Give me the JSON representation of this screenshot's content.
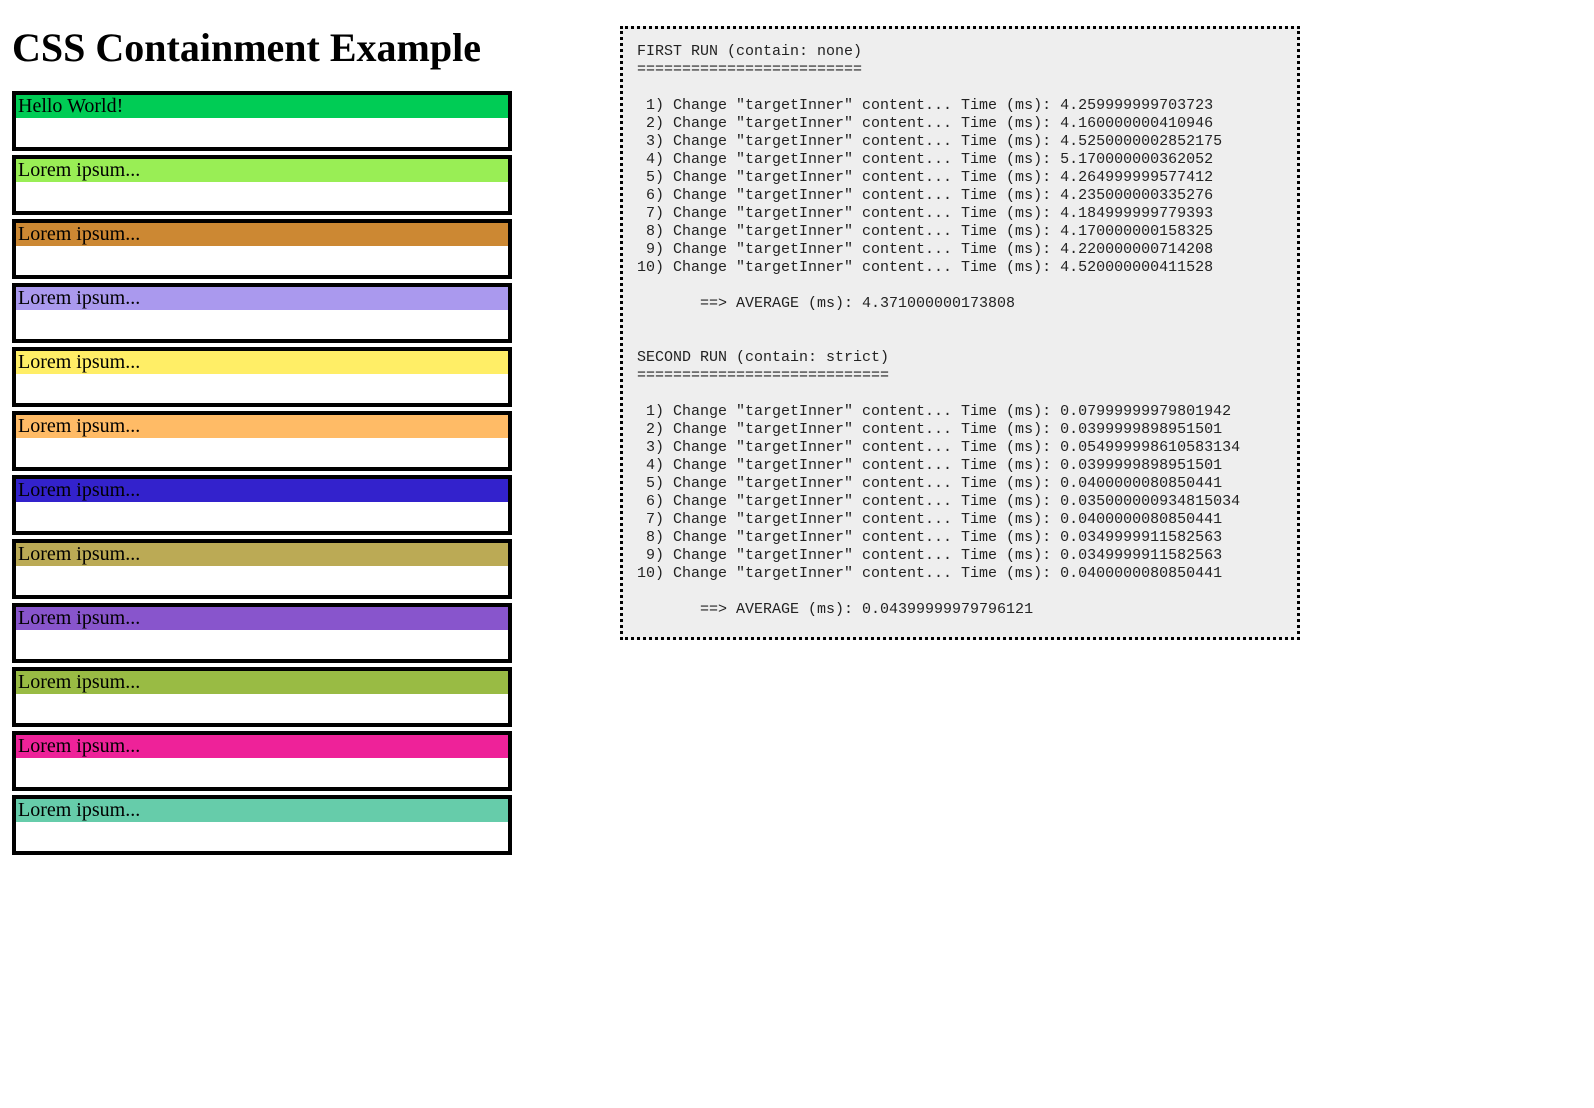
{
  "title": "CSS Containment Example",
  "boxes": [
    {
      "label": "Hello World!",
      "bg": "#00cc55"
    },
    {
      "label": "Lorem ipsum...",
      "bg": "#99ee55"
    },
    {
      "label": "Lorem ipsum...",
      "bg": "#cc8833"
    },
    {
      "label": "Lorem ipsum...",
      "bg": "#aa99ee"
    },
    {
      "label": "Lorem ipsum...",
      "bg": "#ffee66"
    },
    {
      "label": "Lorem ipsum...",
      "bg": "#ffbb66"
    },
    {
      "label": "Lorem ipsum...",
      "bg": "#3322cc"
    },
    {
      "label": "Lorem ipsum...",
      "bg": "#bbaa55"
    },
    {
      "label": "Lorem ipsum...",
      "bg": "#8855cc"
    },
    {
      "label": "Lorem ipsum...",
      "bg": "#99bb44"
    },
    {
      "label": "Lorem ipsum...",
      "bg": "#ee2299"
    },
    {
      "label": "Lorem ipsum...",
      "bg": "#66ccaa"
    }
  ],
  "log": {
    "run1_header": "FIRST RUN (contain: none)",
    "run1_sep": "=========================",
    "run1_items": [
      " 1) Change \"targetInner\" content... Time (ms): 4.259999999703723",
      " 2) Change \"targetInner\" content... Time (ms): 4.160000000410946",
      " 3) Change \"targetInner\" content... Time (ms): 4.5250000002852175",
      " 4) Change \"targetInner\" content... Time (ms): 5.170000000362052",
      " 5) Change \"targetInner\" content... Time (ms): 4.264999999577412",
      " 6) Change \"targetInner\" content... Time (ms): 4.235000000335276",
      " 7) Change \"targetInner\" content... Time (ms): 4.184999999779393",
      " 8) Change \"targetInner\" content... Time (ms): 4.170000000158325",
      " 9) Change \"targetInner\" content... Time (ms): 4.220000000714208",
      "10) Change \"targetInner\" content... Time (ms): 4.520000000411528"
    ],
    "run1_avg": "       ==> AVERAGE (ms): 4.371000000173808",
    "run2_header": "SECOND RUN (contain: strict)",
    "run2_sep": "============================",
    "run2_items": [
      " 1) Change \"targetInner\" content... Time (ms): 0.07999999979801942",
      " 2) Change \"targetInner\" content... Time (ms): 0.0399999898951501",
      " 3) Change \"targetInner\" content... Time (ms): 0.054999998610583134",
      " 4) Change \"targetInner\" content... Time (ms): 0.0399999898951501",
      " 5) Change \"targetInner\" content... Time (ms): 0.0400000080850441",
      " 6) Change \"targetInner\" content... Time (ms): 0.035000000934815034",
      " 7) Change \"targetInner\" content... Time (ms): 0.0400000080850441",
      " 8) Change \"targetInner\" content... Time (ms): 0.0349999911582563",
      " 9) Change \"targetInner\" content... Time (ms): 0.0349999911582563",
      "10) Change \"targetInner\" content... Time (ms): 0.0400000080850441"
    ],
    "run2_avg": "       ==> AVERAGE (ms): 0.04399999979796121"
  }
}
